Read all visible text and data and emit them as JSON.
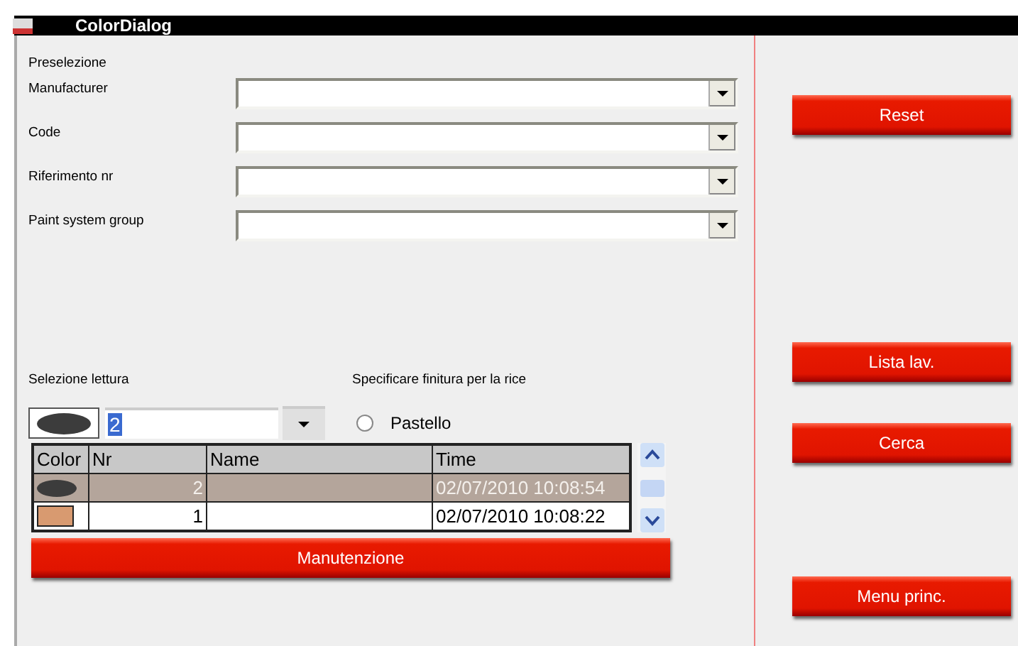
{
  "window": {
    "title": "ColorDialog"
  },
  "preselection": {
    "label": "Preselezione",
    "fields": [
      {
        "label": "Manufacturer"
      },
      {
        "label": "Code"
      },
      {
        "label": "Riferimento nr"
      },
      {
        "label": "Paint system group"
      }
    ]
  },
  "reading": {
    "label": "Selezione lettura",
    "value": "2",
    "value_selected": true
  },
  "finish": {
    "label": "Specificare finitura per la rice",
    "option": {
      "label": "Pastello",
      "selected": false
    }
  },
  "table": {
    "columns": [
      "Color",
      "Nr",
      "Name",
      "Time"
    ],
    "rows": [
      {
        "kind": "ellipse",
        "color": "#3c3c3c",
        "nr": "2",
        "time": "02/07/2010 10:08:54",
        "selected": true
      },
      {
        "kind": "rect",
        "color": "#d89a70",
        "nr": "1",
        "time": "02/07/2010 10:08:22",
        "selected": false
      }
    ]
  },
  "maintenance_button": "Manutenzione",
  "side_buttons": [
    {
      "label": "Reset"
    },
    {
      "label": "Lista lav."
    },
    {
      "label": "Cerca"
    },
    {
      "label": "Menu princ."
    }
  ]
}
